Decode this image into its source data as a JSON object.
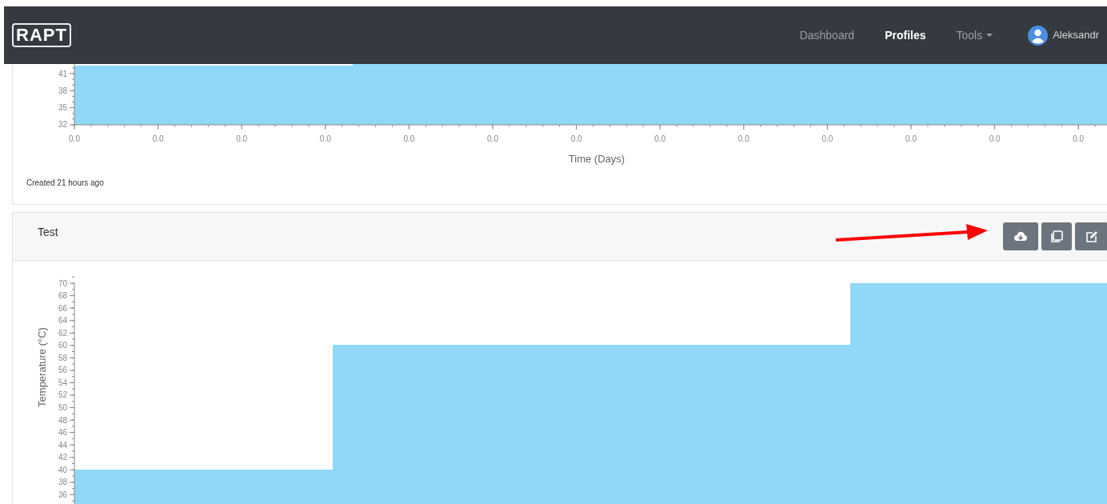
{
  "navbar": {
    "logo": "RAPT",
    "items": [
      {
        "label": "Dashboard",
        "selected": false,
        "kind": "link"
      },
      {
        "label": "Profiles",
        "selected": true,
        "kind": "link"
      },
      {
        "label": "Tools",
        "selected": false,
        "kind": "dropdown"
      }
    ],
    "user": {
      "name": "Aleksandr"
    }
  },
  "profiles": [
    {
      "chart": {
        "x_axis_title": "Time (Days)",
        "x_tick_labels": [
          "0.0",
          "0.0",
          "0.0",
          "0.0",
          "0.0",
          "0.0",
          "0.0",
          "0.0",
          "0.0",
          "0.0",
          "0.0",
          "0.0",
          "0.0"
        ],
        "y_tick_labels": [
          "41",
          "38",
          "35",
          "32"
        ]
      },
      "created": "Created 21 hours ago"
    },
    {
      "title": "Test",
      "actions": [
        {
          "kind": "download"
        },
        {
          "kind": "copy"
        },
        {
          "kind": "edit"
        }
      ],
      "chart": {
        "y_axis_title": "Temperature (°C)",
        "y_tick_labels": [
          "70",
          "68",
          "66",
          "64",
          "62",
          "60",
          "58",
          "56",
          "54",
          "52",
          "50",
          "48",
          "46",
          "44",
          "42",
          "40",
          "38",
          "36"
        ]
      }
    }
  ]
}
